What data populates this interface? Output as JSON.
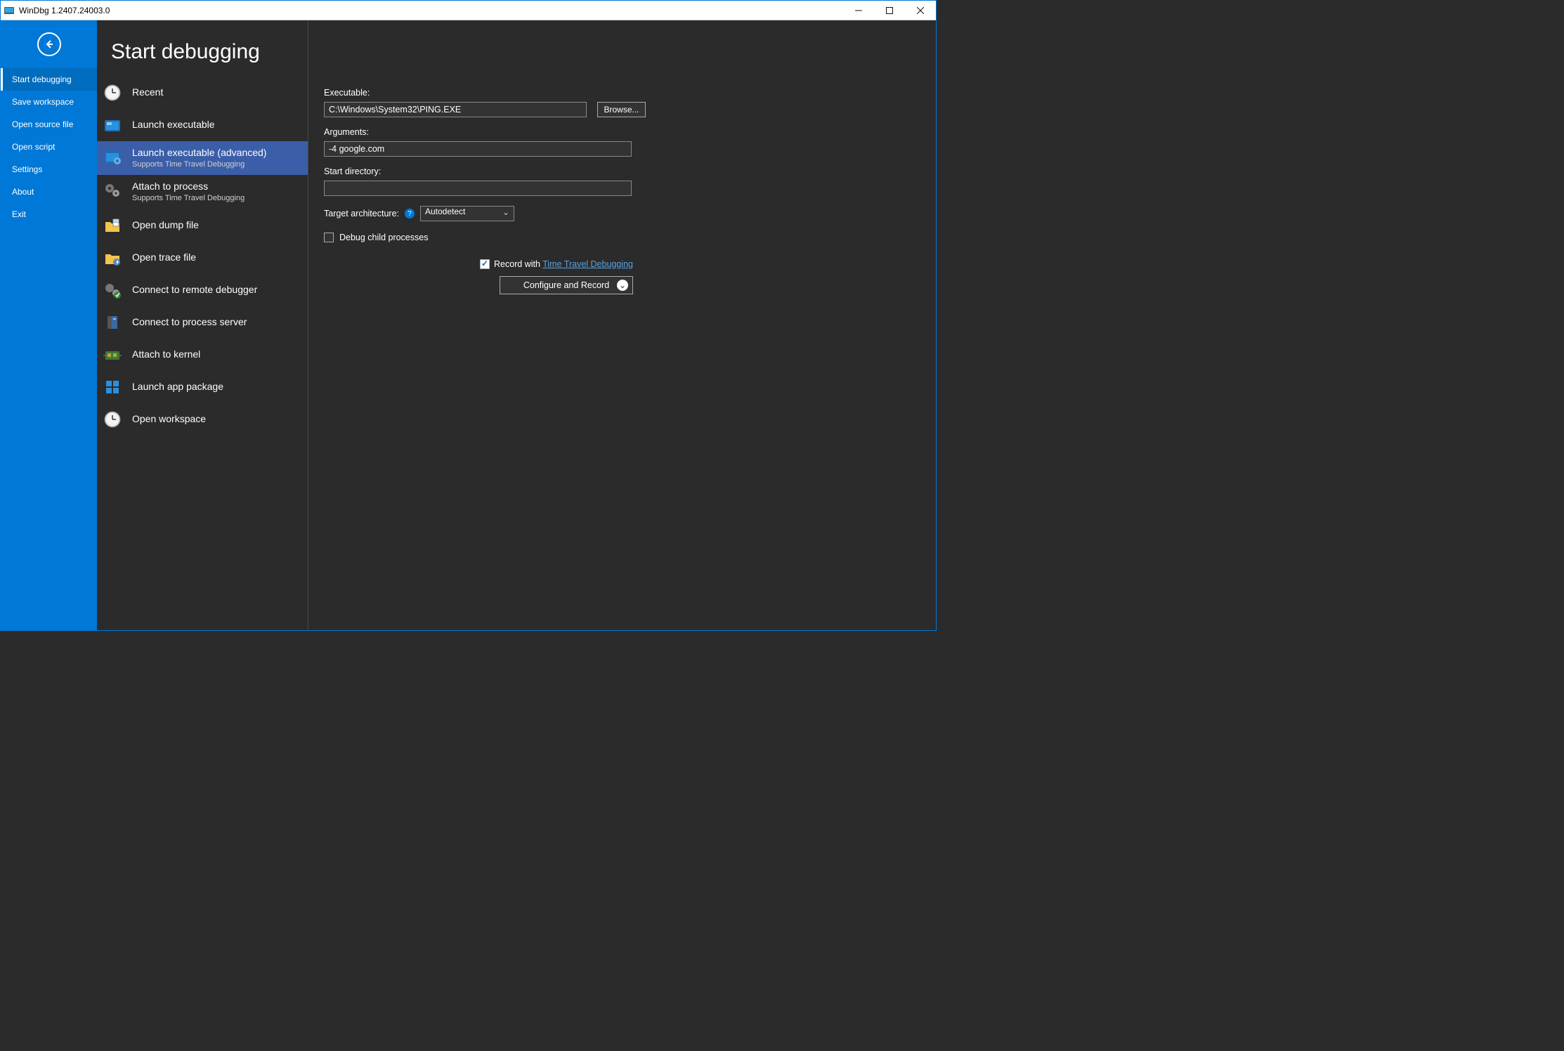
{
  "titlebar": {
    "title": "WinDbg 1.2407.24003.0"
  },
  "sidebar": {
    "items": [
      {
        "label": "Start debugging",
        "selected": true
      },
      {
        "label": "Save workspace"
      },
      {
        "label": "Open source file"
      },
      {
        "label": "Open script"
      },
      {
        "label": "Settings"
      },
      {
        "label": "About"
      },
      {
        "label": "Exit"
      }
    ]
  },
  "page": {
    "title": "Start debugging"
  },
  "options": [
    {
      "label": "Recent"
    },
    {
      "label": "Launch executable"
    },
    {
      "label": "Launch executable (advanced)",
      "sub": "Supports Time Travel Debugging",
      "selected": true
    },
    {
      "label": "Attach to process",
      "sub": "Supports Time Travel Debugging"
    },
    {
      "label": "Open dump file"
    },
    {
      "label": "Open trace file"
    },
    {
      "label": "Connect to remote debugger"
    },
    {
      "label": "Connect to process server"
    },
    {
      "label": "Attach to kernel"
    },
    {
      "label": "Launch app package"
    },
    {
      "label": "Open workspace"
    }
  ],
  "form": {
    "executable_label": "Executable:",
    "executable_value": "C:\\Windows\\System32\\PING.EXE",
    "browse_label": "Browse...",
    "arguments_label": "Arguments:",
    "arguments_value": "-4 google.com",
    "startdir_label": "Start directory:",
    "startdir_value": "",
    "arch_label": "Target architecture:",
    "arch_value": "Autodetect",
    "debug_children_label": "Debug child processes",
    "debug_children_checked": false,
    "record_label": "Record with ",
    "record_link": "Time Travel Debugging",
    "record_checked": true,
    "configure_label": "Configure and Record"
  }
}
